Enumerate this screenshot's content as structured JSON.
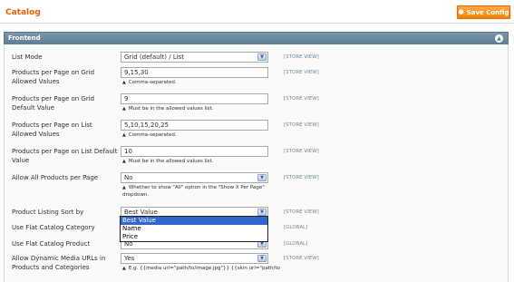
{
  "header": {
    "title": "Catalog",
    "save_label": "Save Config",
    "save_icon": "save-icon"
  },
  "section": {
    "title": "Frontend",
    "collapse_icon": "collapse-icon"
  },
  "rows": [
    {
      "label": "List Mode",
      "type": "select",
      "value": "Grid (default) / List",
      "scope": "[STORE VIEW]"
    },
    {
      "label": "Products per Page on Grid Allowed Values",
      "type": "text",
      "value": "9,15,30",
      "note": "Comma-separated.",
      "scope": "[STORE VIEW]"
    },
    {
      "label": "Products per Page on Grid Default Value",
      "type": "text",
      "value": "9",
      "note": "Must be in the allowed values list.",
      "scope": "[STORE VIEW]"
    },
    {
      "label": "Products per Page on List Allowed Values",
      "type": "text",
      "value": "5,10,15,20,25",
      "note": "Comma-separated.",
      "scope": "[STORE VIEW]"
    },
    {
      "label": "Products per Page on List Default Value",
      "type": "text",
      "value": "10",
      "note": "Must be in the allowed values list.",
      "scope": "[STORE VIEW]"
    },
    {
      "label": "Allow All Products per Page",
      "type": "select",
      "value": "No",
      "note": "Whether to show \"All\" option in the \"Show X Per Page\" dropdown.",
      "scope": "[STORE VIEW]"
    },
    {
      "label": "Product Listing Sort by",
      "type": "select",
      "value": "Best Value",
      "scope": "[STORE VIEW]"
    },
    {
      "label": "Use Flat Catalog Category",
      "type": "select",
      "value": "",
      "scope": "[GLOBAL]"
    },
    {
      "label": "Use Flat Catalog Product",
      "type": "select",
      "value": "No",
      "scope": "[GLOBAL]"
    },
    {
      "label": "Allow Dynamic Media URLs in Products and Categories",
      "type": "select",
      "value": "Yes",
      "note": "E.g. {{media url=\"path/to/image.jpg\"}} {{skin url=\"path/to",
      "scope": "[STORE VIEW]"
    }
  ],
  "sort_dropdown": {
    "options": [
      "Best Value",
      "Name",
      "Price"
    ],
    "selected": "Best Value"
  },
  "colors": {
    "title": "#eb5e00",
    "button": "#f18200",
    "section_header": "#6b889e",
    "selected_option": "#3366cc",
    "scope_text": "#6f8992"
  }
}
